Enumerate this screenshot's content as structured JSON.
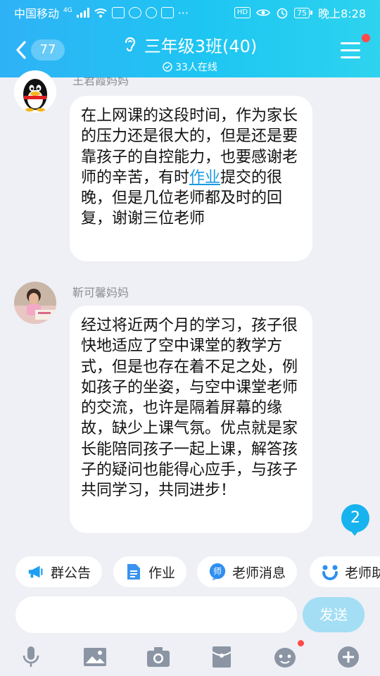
{
  "status_bar": {
    "carrier": "中国移动",
    "network": "4G",
    "hd_label": "HD",
    "battery": "75",
    "time": "晚上8:28",
    "more": "···"
  },
  "header": {
    "back_count": "77",
    "title": "三年级3班(40)",
    "online": "33人在线"
  },
  "messages": [
    {
      "sender": "王君霞妈妈",
      "text_before": "在上网课的这段时间，作为家长的压力还是很大的，但是还是要靠孩子的自控能力，也要感谢老师的辛苦，有时",
      "link": "作业",
      "text_after": "提交的很晚，但是几位老师都及时的回复，谢谢三位老师"
    },
    {
      "sender": "靳可馨妈妈",
      "text": "经过将近两个月的学习，孩子很快地适应了空中课堂的教学方式，但是也存在着不足之处，例如孩子的坐姿，与空中课堂老师的交流，也许是隔着屏幕的缘故，缺少上课气氛。优点就是家长能陪同孩子一起上课，解答孩子的疑问也能得心应手，与孩子共同学习，共同进步！"
    }
  ],
  "new_messages_badge": "2",
  "quick_actions": [
    {
      "label": "群公告",
      "icon": "megaphone-icon"
    },
    {
      "label": "作业",
      "icon": "document-icon"
    },
    {
      "label": "老师消息",
      "icon": "teacher-icon"
    },
    {
      "label": "老师助",
      "icon": "people-icon"
    }
  ],
  "composer": {
    "placeholder": "",
    "send_label": "发送"
  },
  "toolbar": [
    "microphone-icon",
    "image-icon",
    "camera-icon",
    "red-packet-icon",
    "emoji-icon",
    "plus-icon"
  ],
  "colors": {
    "header_start": "#2fb2f6",
    "header_end": "#2ed3ee",
    "background": "#eef0f5",
    "link": "#1a9be0",
    "send_disabled": "#a3def5",
    "badge": "#17b3ef",
    "notify_dot": "#ff4a4a"
  }
}
